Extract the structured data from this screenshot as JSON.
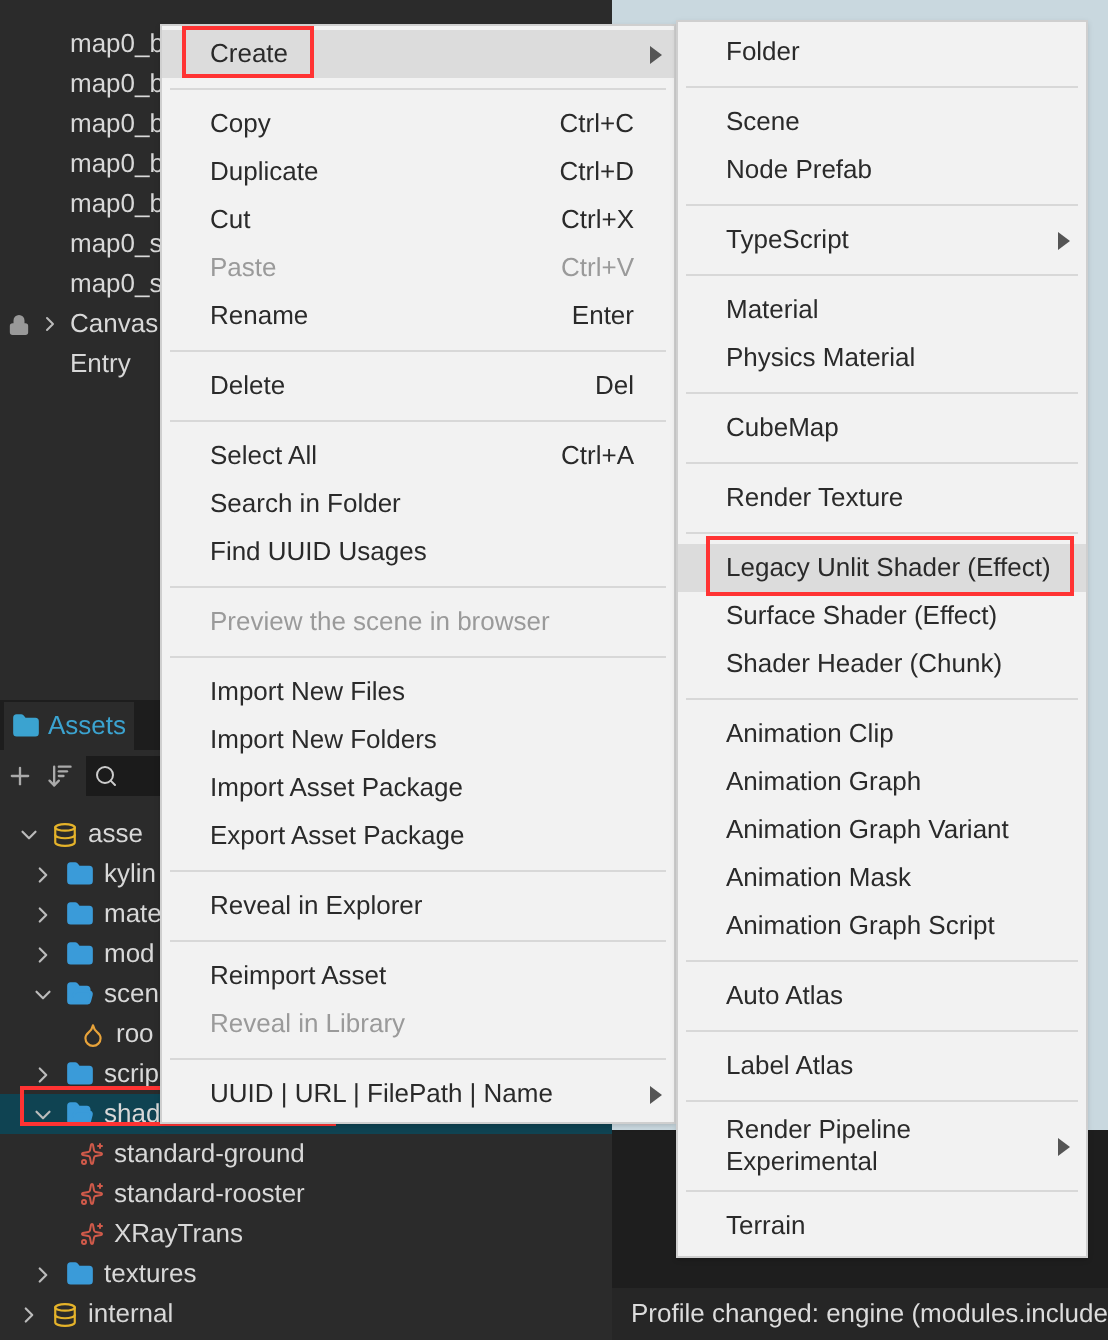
{
  "hierarchy": {
    "nodes": [
      {
        "label": "map0_b",
        "kind": "node"
      },
      {
        "label": "map0_b",
        "kind": "node"
      },
      {
        "label": "map0_b",
        "kind": "node"
      },
      {
        "label": "map0_b",
        "kind": "node"
      },
      {
        "label": "map0_b",
        "kind": "node"
      },
      {
        "label": "map0_s",
        "kind": "node"
      },
      {
        "label": "map0_s",
        "kind": "node"
      },
      {
        "label": "Canvas",
        "kind": "locked"
      },
      {
        "label": "Entry",
        "kind": "node"
      }
    ]
  },
  "assets_panel": {
    "tab": {
      "label": "Assets",
      "selected": true
    },
    "tree": [
      {
        "label": "asse",
        "kind": "db",
        "expanded": true,
        "selected": false,
        "highlighted": false,
        "children": [
          {
            "label": "kylin",
            "kind": "folder",
            "expanded": false,
            "selected": false,
            "highlighted": false
          },
          {
            "label": "mate",
            "kind": "folder",
            "expanded": false,
            "selected": false,
            "highlighted": false
          },
          {
            "label": "mod",
            "kind": "folder",
            "expanded": false,
            "selected": false,
            "highlighted": false
          },
          {
            "label": "scen",
            "kind": "folder",
            "expanded": true,
            "selected": false,
            "highlighted": false,
            "children": [
              {
                "label": "roo",
                "kind": "scene",
                "selected": false,
                "highlighted": false
              }
            ]
          },
          {
            "label": "scrip",
            "kind": "folder",
            "expanded": false,
            "selected": false,
            "highlighted": false
          },
          {
            "label": "shad",
            "kind": "folder",
            "expanded": true,
            "selected": true,
            "highlighted": true,
            "children": [
              {
                "label": "standard-ground",
                "kind": "shader",
                "selected": false,
                "highlighted": false
              },
              {
                "label": "standard-rooster",
                "kind": "shader",
                "selected": false,
                "highlighted": false
              },
              {
                "label": "XRayTrans",
                "kind": "shader",
                "selected": false,
                "highlighted": false
              }
            ]
          },
          {
            "label": "textures",
            "kind": "folder",
            "expanded": false,
            "selected": false,
            "highlighted": false
          }
        ]
      },
      {
        "label": "internal",
        "kind": "db",
        "expanded": false,
        "selected": false,
        "highlighted": false
      }
    ]
  },
  "console": {
    "lines": [
      "Profile changed: engine (modules.include"
    ]
  },
  "context_menu": {
    "groups": [
      [
        {
          "label": "Create",
          "submenu": true,
          "hovered": true,
          "highlighted": true,
          "disabled": false
        }
      ],
      [
        {
          "label": "Copy",
          "shortcut": "Ctrl+C",
          "disabled": false
        },
        {
          "label": "Duplicate",
          "shortcut": "Ctrl+D",
          "disabled": false
        },
        {
          "label": "Cut",
          "shortcut": "Ctrl+X",
          "disabled": false
        },
        {
          "label": "Paste",
          "shortcut": "Ctrl+V",
          "disabled": true
        },
        {
          "label": "Rename",
          "shortcut": "Enter",
          "disabled": false
        }
      ],
      [
        {
          "label": "Delete",
          "shortcut": "Del",
          "disabled": false
        }
      ],
      [
        {
          "label": "Select All",
          "shortcut": "Ctrl+A",
          "disabled": false
        },
        {
          "label": "Search in Folder",
          "disabled": false
        },
        {
          "label": "Find UUID Usages",
          "disabled": false
        }
      ],
      [
        {
          "label": "Preview the scene in browser",
          "disabled": true
        }
      ],
      [
        {
          "label": "Import New Files",
          "disabled": false
        },
        {
          "label": "Import New Folders",
          "disabled": false
        },
        {
          "label": "Import Asset Package",
          "disabled": false
        },
        {
          "label": "Export Asset Package",
          "disabled": false
        }
      ],
      [
        {
          "label": "Reveal in Explorer",
          "disabled": false
        }
      ],
      [
        {
          "label": "Reimport Asset",
          "disabled": false
        },
        {
          "label": "Reveal in Library",
          "disabled": true
        }
      ],
      [
        {
          "label": "UUID | URL | FilePath | Name",
          "submenu": true,
          "disabled": false
        }
      ]
    ]
  },
  "create_submenu": {
    "groups": [
      [
        {
          "label": "Folder"
        }
      ],
      [
        {
          "label": "Scene"
        },
        {
          "label": "Node Prefab"
        }
      ],
      [
        {
          "label": "TypeScript",
          "submenu": true
        }
      ],
      [
        {
          "label": "Material"
        },
        {
          "label": "Physics Material"
        }
      ],
      [
        {
          "label": "CubeMap"
        }
      ],
      [
        {
          "label": "Render Texture"
        }
      ],
      [
        {
          "label": "Legacy Unlit Shader (Effect)",
          "hovered": true,
          "highlighted": true
        },
        {
          "label": "Surface Shader (Effect)"
        },
        {
          "label": "Shader Header (Chunk)"
        }
      ],
      [
        {
          "label": "Animation Clip"
        },
        {
          "label": "Animation Graph"
        },
        {
          "label": "Animation Graph Variant"
        },
        {
          "label": "Animation Mask"
        },
        {
          "label": "Animation Graph Script"
        }
      ],
      [
        {
          "label": "Auto Atlas"
        }
      ],
      [
        {
          "label": "Label Atlas"
        }
      ],
      [
        {
          "label": "Render Pipeline",
          "sublabel": "Experimental",
          "submenu": true
        }
      ],
      [
        {
          "label": "Terrain"
        }
      ]
    ]
  }
}
